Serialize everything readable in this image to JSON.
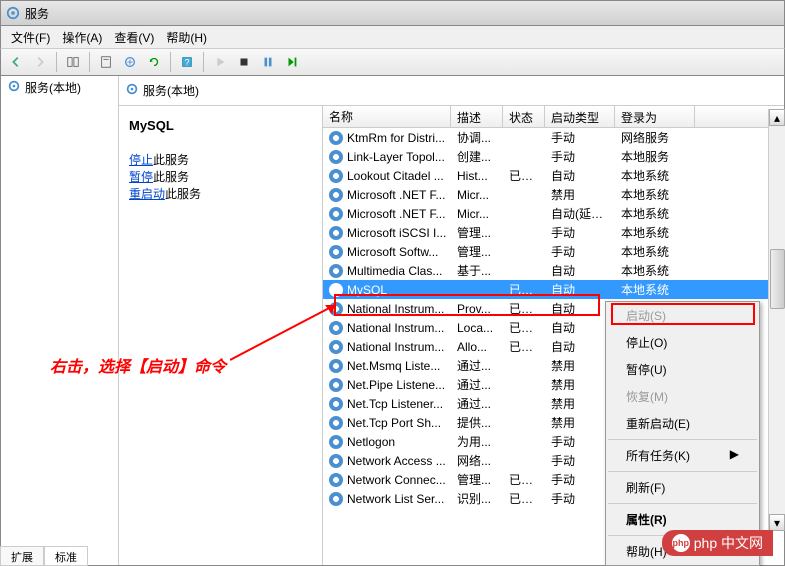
{
  "window": {
    "title": "服务"
  },
  "menu": {
    "file": "文件(F)",
    "action": "操作(A)",
    "view": "查看(V)",
    "help": "帮助(H)"
  },
  "sidebar": {
    "label": "服务(本地)"
  },
  "main_header": {
    "label": "服务(本地)"
  },
  "detail": {
    "service_name": "MySQL",
    "stop_prefix": "停止",
    "pause_prefix": "暂停",
    "restart_prefix": "重启动",
    "suffix": "此服务"
  },
  "columns": {
    "name": "名称",
    "description": "描述",
    "status": "状态",
    "startup": "启动类型",
    "logon": "登录为"
  },
  "rows": [
    {
      "name": "KtmRm for Distri...",
      "desc": "协调...",
      "status": "",
      "startup": "手动",
      "logon": "网络服务"
    },
    {
      "name": "Link-Layer Topol...",
      "desc": "创建...",
      "status": "",
      "startup": "手动",
      "logon": "本地服务"
    },
    {
      "name": "Lookout Citadel ...",
      "desc": "Hist...",
      "status": "已启动",
      "startup": "自动",
      "logon": "本地系统"
    },
    {
      "name": "Microsoft .NET F...",
      "desc": "Micr...",
      "status": "",
      "startup": "禁用",
      "logon": "本地系统"
    },
    {
      "name": "Microsoft .NET F...",
      "desc": "Micr...",
      "status": "",
      "startup": "自动(延迟...",
      "logon": "本地系统"
    },
    {
      "name": "Microsoft iSCSI I...",
      "desc": "管理...",
      "status": "",
      "startup": "手动",
      "logon": "本地系统"
    },
    {
      "name": "Microsoft Softw...",
      "desc": "管理...",
      "status": "",
      "startup": "手动",
      "logon": "本地系统"
    },
    {
      "name": "Multimedia Clas...",
      "desc": "基于...",
      "status": "",
      "startup": "自动",
      "logon": "本地系统"
    },
    {
      "name": "MySQL",
      "desc": "",
      "status": "已启动",
      "startup": "自动",
      "logon": "本地系统",
      "selected": true
    },
    {
      "name": "National Instrum...",
      "desc": "Prov...",
      "status": "已启动",
      "startup": "自动",
      "logon": ""
    },
    {
      "name": "National Instrum...",
      "desc": "Loca...",
      "status": "已启动",
      "startup": "自动",
      "logon": ""
    },
    {
      "name": "National Instrum...",
      "desc": "Allo...",
      "status": "已启动",
      "startup": "自动",
      "logon": ""
    },
    {
      "name": "Net.Msmq Liste...",
      "desc": "通过...",
      "status": "",
      "startup": "禁用",
      "logon": ""
    },
    {
      "name": "Net.Pipe Listene...",
      "desc": "通过...",
      "status": "",
      "startup": "禁用",
      "logon": ""
    },
    {
      "name": "Net.Tcp Listener...",
      "desc": "通过...",
      "status": "",
      "startup": "禁用",
      "logon": ""
    },
    {
      "name": "Net.Tcp Port Sh...",
      "desc": "提供...",
      "status": "",
      "startup": "禁用",
      "logon": ""
    },
    {
      "name": "Netlogon",
      "desc": "为用...",
      "status": "",
      "startup": "手动",
      "logon": ""
    },
    {
      "name": "Network Access ...",
      "desc": "网络...",
      "status": "",
      "startup": "手动",
      "logon": ""
    },
    {
      "name": "Network Connec...",
      "desc": "管理...",
      "status": "已启动",
      "startup": "手动",
      "logon": ""
    },
    {
      "name": "Network List Ser...",
      "desc": "识别...",
      "status": "已启动",
      "startup": "手动",
      "logon": ""
    }
  ],
  "tabs": {
    "extended": "扩展",
    "standard": "标准"
  },
  "context": {
    "start": "启动(S)",
    "stop": "停止(O)",
    "pause": "暂停(U)",
    "resume": "恢复(M)",
    "restart": "重新启动(E)",
    "all_tasks": "所有任务(K)",
    "refresh": "刷新(F)",
    "properties": "属性(R)",
    "help": "帮助(H)",
    "arrow": "▶"
  },
  "annotation": {
    "text": "右击，选择【启动】命令"
  },
  "watermark": {
    "text": "php 中文网"
  }
}
